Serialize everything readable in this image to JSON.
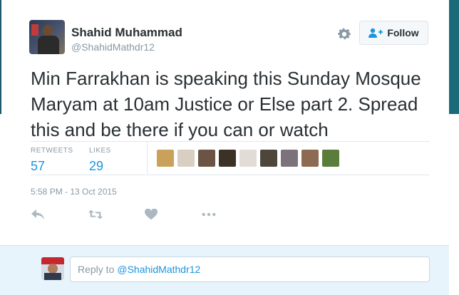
{
  "author": {
    "name": "Shahid Muhammad",
    "handle": "@ShahidMathdr12"
  },
  "header": {
    "follow_label": "Follow",
    "accent_color": "#1b95e0"
  },
  "tweet": {
    "text": "Min Farrakhan is speaking this Sunday Mosque Maryam at 10am Justice or Else part 2. Spread this and be there if you can or watch",
    "timestamp": "5:58 PM - 13 Oct 2015"
  },
  "stats": {
    "retweets_label": "RETWEETS",
    "retweets_value": "57",
    "likes_label": "LIKES",
    "likes_value": "29"
  },
  "favoriters": [
    {
      "icon": "avatar-1",
      "color": "#c9a15a"
    },
    {
      "icon": "avatar-2",
      "color": "#d8cfc2"
    },
    {
      "icon": "avatar-3",
      "color": "#6b5444"
    },
    {
      "icon": "avatar-4",
      "color": "#3b3126"
    },
    {
      "icon": "avatar-5",
      "color": "#e2dcd6"
    },
    {
      "icon": "avatar-6",
      "color": "#4e453b"
    },
    {
      "icon": "avatar-7",
      "color": "#7c737a"
    },
    {
      "icon": "avatar-8",
      "color": "#8d6b52"
    },
    {
      "icon": "avatar-9",
      "color": "#5b7d3c"
    }
  ],
  "actions": [
    {
      "icon": "reply-icon"
    },
    {
      "icon": "retweet-icon"
    },
    {
      "icon": "like-icon"
    },
    {
      "icon": "more-icon"
    }
  ],
  "reply": {
    "prefix": "Reply to",
    "mention": "@ShahidMathdr12"
  }
}
